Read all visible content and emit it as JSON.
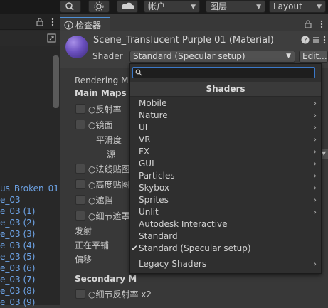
{
  "toolbar": {
    "layers_label": "图层",
    "account_label": "帐户",
    "layout_label": "Layout"
  },
  "left_panel": {
    "hierarchy_items": [
      "us_Broken_01",
      "e_03",
      "e_03 (1)",
      "e_03 (2)",
      "e_03 (3)",
      "e_03 (4)",
      "e_03 (5)",
      "e_03 (6)",
      "e_03 (7)",
      "e_03 (8)",
      "e_03 (9)"
    ]
  },
  "inspector": {
    "tab_label": "检查器",
    "material_title": "Scene_Translucent Purple 01 (Material)",
    "shader_label": "Shader",
    "shader_value": "Standard (Specular setup)",
    "edit_label": "Edit...",
    "rendering_mode_label": "Rendering M",
    "main_maps_label": "Main Maps",
    "properties": [
      "○反射率",
      "○镜面",
      "平滑度",
      "源",
      "○法线贴图",
      "○高度贴图",
      "○遮挡",
      "○细节遮罩"
    ],
    "emission_label": "发射",
    "tiling_label": "正在平铺",
    "offset_label": "偏移",
    "secondary_maps_label": "Secondary M",
    "detail_albedo_label": "○细节反射率 x2"
  },
  "shader_popup": {
    "search_value": "",
    "title": "Shaders",
    "items": [
      {
        "label": "Mobile",
        "submenu": true
      },
      {
        "label": "Nature",
        "submenu": true
      },
      {
        "label": "UI",
        "submenu": true
      },
      {
        "label": "VR",
        "submenu": true
      },
      {
        "label": "FX",
        "submenu": true
      },
      {
        "label": "GUI",
        "submenu": true
      },
      {
        "label": "Particles",
        "submenu": true
      },
      {
        "label": "Skybox",
        "submenu": true
      },
      {
        "label": "Sprites",
        "submenu": true
      },
      {
        "label": "Unlit",
        "submenu": true
      },
      {
        "label": "Autodesk Interactive",
        "submenu": false
      },
      {
        "label": "Standard",
        "submenu": false
      },
      {
        "label": "Standard (Specular setup)",
        "submenu": false,
        "checked": true
      }
    ],
    "legacy_label": "Legacy Shaders"
  },
  "colors": {
    "accent": "#4d8fd6",
    "link_blue": "#6da3e6",
    "material_purple": "#6b50bf"
  }
}
